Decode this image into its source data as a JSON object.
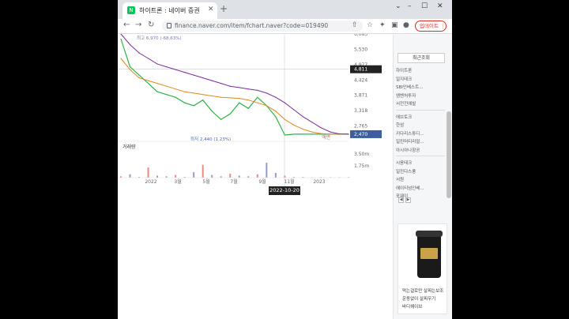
{
  "browser": {
    "tab_title": "하이트론 : 네이버 증권",
    "tab_favicon": "N",
    "url": "finance.naver.com/item/fchart.naver?code=019490",
    "update_label": "업데이트"
  },
  "chart_data": {
    "type": "line",
    "title": "",
    "series": [
      {
        "name": "price",
        "color": "#2db34a",
        "values": [
          5900,
          4900,
          4600,
          4300,
          4000,
          3900,
          3800,
          3600,
          3500,
          3700,
          3300,
          3000,
          3200,
          3600,
          3400,
          3800,
          3500,
          3100,
          2440,
          2470,
          2470,
          2470,
          2470,
          2470,
          2470,
          2470
        ]
      },
      {
        "name": "ma-orange",
        "color": "#e08a1a",
        "values": [
          5200,
          4800,
          4500,
          4400,
          4300,
          4200,
          4100,
          4000,
          3950,
          3900,
          3850,
          3800,
          3780,
          3760,
          3700,
          3600,
          3500,
          3300,
          3000,
          2800,
          2650,
          2550,
          2490,
          2470,
          2470,
          2470
        ]
      },
      {
        "name": "ma-purple",
        "color": "#7b2d9e",
        "values": [
          6083,
          5700,
          5400,
          5200,
          5000,
          4900,
          4800,
          4700,
          4600,
          4500,
          4400,
          4300,
          4200,
          4150,
          4100,
          4050,
          3950,
          3800,
          3600,
          3350,
          3100,
          2900,
          2700,
          2550,
          2480,
          2470
        ]
      }
    ],
    "y_ticks": [
      "6,083",
      "5,530",
      "4,977",
      "4,424",
      "3,871",
      "3,318",
      "2,765"
    ],
    "x_ticks": [
      "2022",
      "3월",
      "5월",
      "7월",
      "9월",
      "11월",
      "2023"
    ],
    "ylim": [
      2440,
      6083
    ],
    "high_label": "최고 6,970 (-68.63%)",
    "low_label": "최저 2,440 (1.23%)",
    "current_price": "2,470",
    "crosshair_price": "4,811",
    "crosshair_date": "2022-10-20",
    "watermark": "액면",
    "volume_label": "거래량",
    "volume_ticks": [
      "3.50m",
      "1.75m"
    ],
    "volume_values": [
      0.2,
      0.5,
      0.1,
      1.5,
      0.3,
      0.2,
      0.4,
      0.1,
      0.8,
      1.9,
      0.4,
      0.2,
      0.6,
      0.3,
      0.2,
      0.5,
      2.2,
      0.7,
      0.3,
      0.1,
      0.1,
      0.05,
      0.05,
      0.05,
      0.05,
      0.05
    ],
    "colors": {
      "current_tag": "#3d5fa0",
      "crosshair_tag": "#222222"
    }
  },
  "sidebar": {
    "tab": "최근조회",
    "group1": [
      "하이트론",
      "일지테크",
      "SBI인베스트...",
      "엠벤처투자",
      "서전전예발"
    ],
    "group2": [
      "에브토크",
      "한섬",
      "키다리스튜디...",
      "일진머티리얼...",
      "아시아나항공"
    ],
    "group3": [
      "시옹테크",
      "일진다스풍",
      "서원",
      "에이티넘인베...",
      "포웨이"
    ],
    "pager": [
      "◀",
      "▶"
    ]
  },
  "ad": {
    "line1": "먹는걸로만 살찌는보조",
    "line2": "운동없이 살찌우기",
    "line3": "바디쉐이브"
  }
}
